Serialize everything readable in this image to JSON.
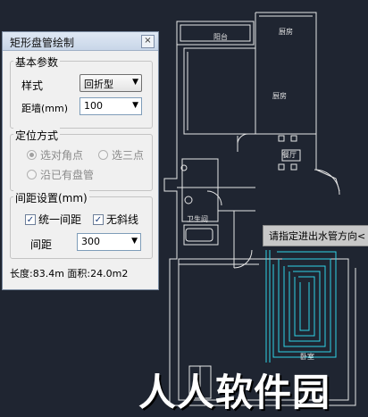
{
  "dialog": {
    "title": "矩形盘管绘制",
    "close_symbol": "×",
    "basic": {
      "legend": "基本参数",
      "style_label": "样式",
      "style_value": "回折型",
      "distance_label": "距墙(mm)",
      "distance_value": "100"
    },
    "positioning": {
      "legend": "定位方式",
      "options": [
        {
          "label": "选对角点",
          "selected": true
        },
        {
          "label": "选三点",
          "selected": false
        },
        {
          "label": "沿已有盘管",
          "selected": false
        }
      ]
    },
    "spacing": {
      "legend": "间距设置(mm)",
      "uniform_label": "统一间距",
      "uniform_checked": true,
      "no_diagonal_label": "无斜线",
      "no_diagonal_checked": true,
      "spacing_label": "间距",
      "spacing_value": "300"
    },
    "status": "长度:83.4m 面积:24.0m2"
  },
  "cad": {
    "room_labels": [
      "阳台",
      "厨房",
      "厨房",
      "餐厅",
      "卫生间",
      "卧室"
    ],
    "tooltip": "请指定进出水管方向<",
    "colors": {
      "background": "#1f2531",
      "walls": "#e6e6e6",
      "pipe": "#2fd4e6"
    }
  },
  "watermark": "人人软件园"
}
